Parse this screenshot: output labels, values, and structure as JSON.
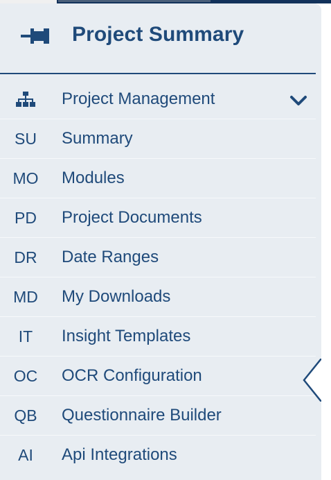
{
  "header": {
    "title": "Project Summary",
    "icon": "pin-icon"
  },
  "menu": {
    "items": [
      {
        "code": "",
        "icon": "sitemap-icon",
        "label": "Project Management",
        "expandable": true
      },
      {
        "code": "SU",
        "label": "Summary"
      },
      {
        "code": "MO",
        "label": "Modules"
      },
      {
        "code": "PD",
        "label": "Project Documents"
      },
      {
        "code": "DR",
        "label": "Date Ranges"
      },
      {
        "code": "MD",
        "label": "My Downloads"
      },
      {
        "code": "IT",
        "label": "Insight Templates"
      },
      {
        "code": "OC",
        "label": "OCR Configuration"
      },
      {
        "code": "QB",
        "label": "Questionnaire Builder"
      },
      {
        "code": "AI",
        "label": "Api Integrations"
      }
    ]
  },
  "colors": {
    "primary": "#1f4a7a",
    "sidebar_bg": "#e8edf2",
    "topbar": "#12325b"
  }
}
